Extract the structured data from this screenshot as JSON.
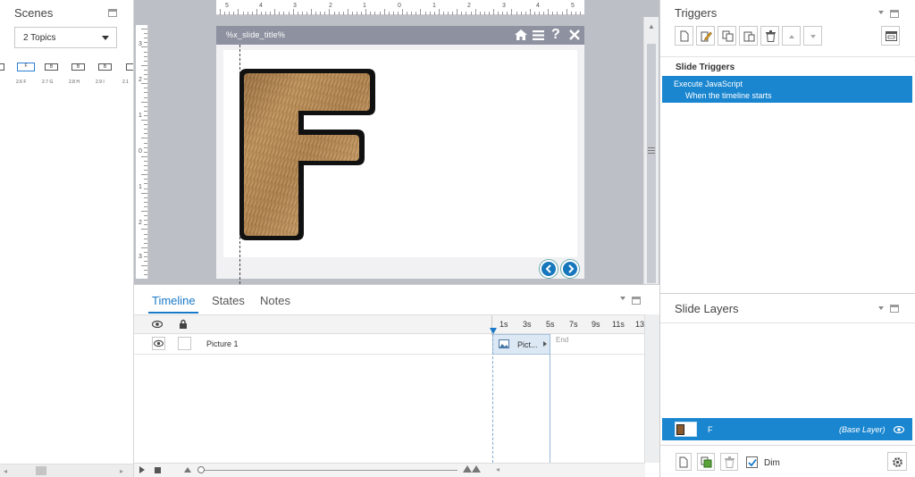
{
  "scenes": {
    "title": "Scenes",
    "topics_select": "2 Topics",
    "thumbs": [
      "F",
      "B",
      "B",
      "B"
    ],
    "labels": [
      "2.6 F",
      "2.7 G",
      "2.8 H",
      "2.9 I",
      "2.1"
    ]
  },
  "stage": {
    "slide_title": "%x_slide_title%",
    "hruler_labels": [
      "5",
      "4",
      "3",
      "2",
      "1",
      "0",
      "1",
      "2",
      "3",
      "4",
      "5"
    ],
    "vruler_labels": [
      "3",
      "2",
      "1",
      "0",
      "1",
      "2",
      "3"
    ],
    "letter": "F"
  },
  "timeline": {
    "tabs": [
      "Timeline",
      "States",
      "Notes"
    ],
    "ticks": [
      "1s",
      "3s",
      "5s",
      "7s",
      "9s",
      "11s",
      "13"
    ],
    "row_name": "Picture 1",
    "clip_label": "Pict...",
    "end_label": "End"
  },
  "triggers": {
    "title": "Triggers",
    "section": "Slide Triggers",
    "item_action": "Execute JavaScript",
    "item_condition": "When the timeline starts"
  },
  "layers": {
    "title": "Slide Layers",
    "layer_name": "F",
    "layer_tag": "(Base Layer)",
    "dim_label": "Dim"
  },
  "colors": {
    "accent": "#1a86d0",
    "nav_button": "#1777bd"
  }
}
